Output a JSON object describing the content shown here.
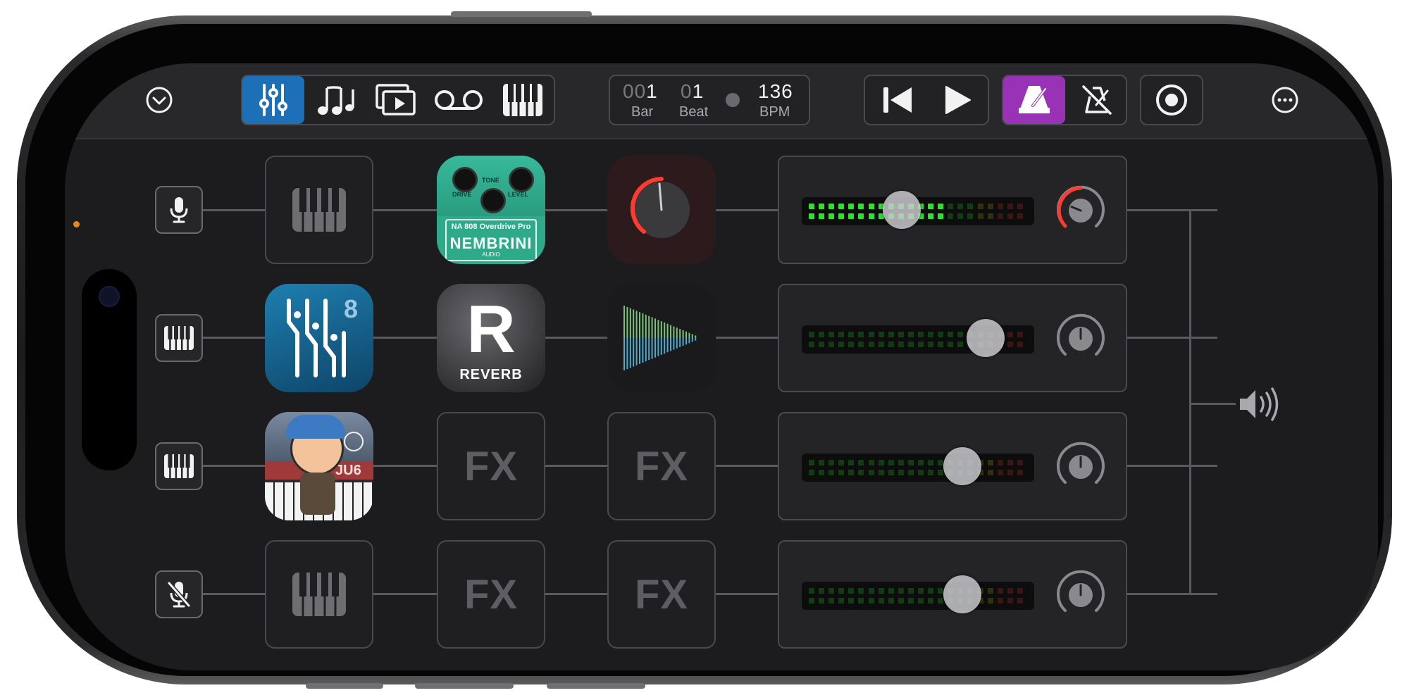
{
  "toolbar": {
    "menu_icon": "chevron-down-circle-icon",
    "view_buttons": [
      {
        "name": "mixer",
        "icon": "sliders-icon",
        "active": true
      },
      {
        "name": "notes",
        "icon": "music-notes-icon",
        "active": false
      },
      {
        "name": "media",
        "icon": "video-stack-icon",
        "active": false
      },
      {
        "name": "tape",
        "icon": "tape-reel-icon",
        "active": false
      },
      {
        "name": "keyboard",
        "icon": "piano-keys-icon",
        "active": false
      }
    ],
    "counter": {
      "bar_dim": "00",
      "bar_value": "1",
      "bar_label": "Bar",
      "beat_dim": "0",
      "beat_value": "1",
      "beat_label": "Beat",
      "bpm_value": "136",
      "bpm_label": "BPM"
    },
    "transport": {
      "rewind_icon": "skip-back-icon",
      "play_icon": "play-icon"
    },
    "metronome": {
      "icon": "metronome-icon",
      "active": true,
      "mute_icon": "metronome-muted-icon"
    },
    "record_icon": "record-icon",
    "more_icon": "ellipsis-circle-icon"
  },
  "tracks": [
    {
      "input": "microphone-icon",
      "instrument": "empty-instrument",
      "fx1": "NA 808 Overdrive Pro",
      "fx2": "knob-plugin",
      "meter_level": 0.65,
      "fader": 0.43,
      "pan": -0.5
    },
    {
      "input": "piano-keys-icon",
      "instrument": "synth-8-app",
      "fx1": "REVERB",
      "fx2": "wave-plugin",
      "meter_level": 0.0,
      "fader": 0.79,
      "pan": 0.0
    },
    {
      "input": "piano-keys-icon",
      "instrument": "ju6-app",
      "fx1": "FX",
      "fx2": "FX",
      "meter_level": 0.0,
      "fader": 0.69,
      "pan": 0.0
    },
    {
      "input": "microphone-muted-icon",
      "instrument": "empty-instrument",
      "fx1": "FX",
      "fx2": "FX",
      "meter_level": 0.0,
      "fader": 0.69,
      "pan": 0.0
    }
  ],
  "apps": {
    "overdrive": {
      "title": "NA 808 Overdrive Pro",
      "brand": "NEMBRINI",
      "brand_sub": "AUDIO",
      "knob_tone": "TONE",
      "knob_drive": "DRIVE",
      "knob_level": "LEVEL"
    },
    "reverb": {
      "letter": "R",
      "label": "REVERB"
    },
    "synth8": {
      "digit": "8"
    },
    "ju6": {
      "label": "JU6"
    }
  },
  "fx_label": "FX",
  "output_icon": "speaker-icon",
  "colors": {
    "accent_blue": "#1d6fb8",
    "accent_purple": "#9a32b8",
    "meter_green": "#2fe02f",
    "pan_red": "#ff3b30"
  }
}
